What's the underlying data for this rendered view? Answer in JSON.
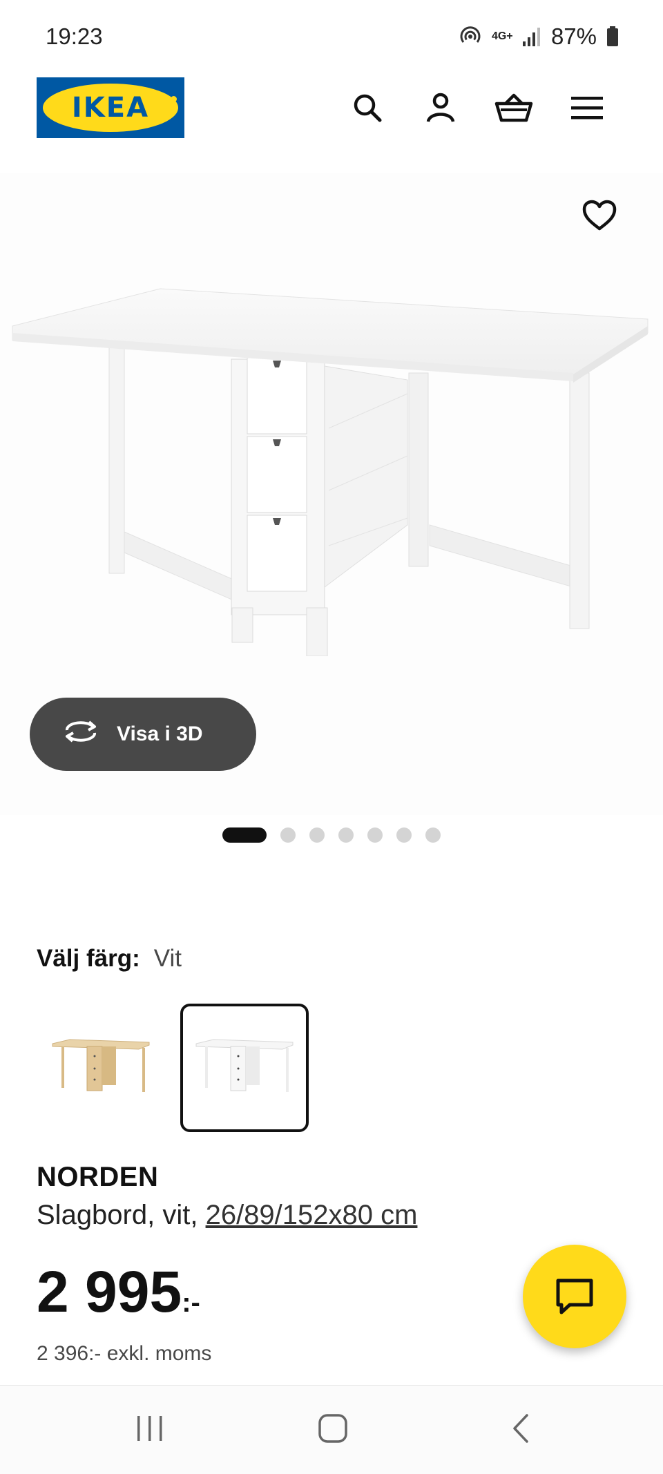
{
  "status_bar": {
    "time": "19:23",
    "network": "4G+",
    "battery": "87%"
  },
  "header": {
    "logo_text": "IKEA",
    "colors": {
      "blue": "#0058a3",
      "yellow": "#ffda1a"
    },
    "icons": [
      "search-icon",
      "account-icon",
      "shopping-basket-icon",
      "menu-icon"
    ]
  },
  "gallery": {
    "view_3d_label": "Visa i 3D",
    "dot_count": 7,
    "active_dot": 1
  },
  "color_picker": {
    "label": "Välj färg:",
    "selected_value": "Vit",
    "options": [
      {
        "name": "birch",
        "selected": false
      },
      {
        "name": "white",
        "selected": true
      }
    ]
  },
  "product": {
    "name": "NORDEN",
    "description_prefix": "Slagbord, vit, ",
    "measurements": "26/89/152x80 cm",
    "price": "2 995",
    "price_suffix": ":-",
    "price_excl_vat": "2 396:- exkl. moms"
  },
  "chat": {
    "icon": "chat-icon"
  },
  "system_nav": {
    "icons": [
      "recent-apps-icon",
      "home-icon",
      "back-icon"
    ]
  }
}
